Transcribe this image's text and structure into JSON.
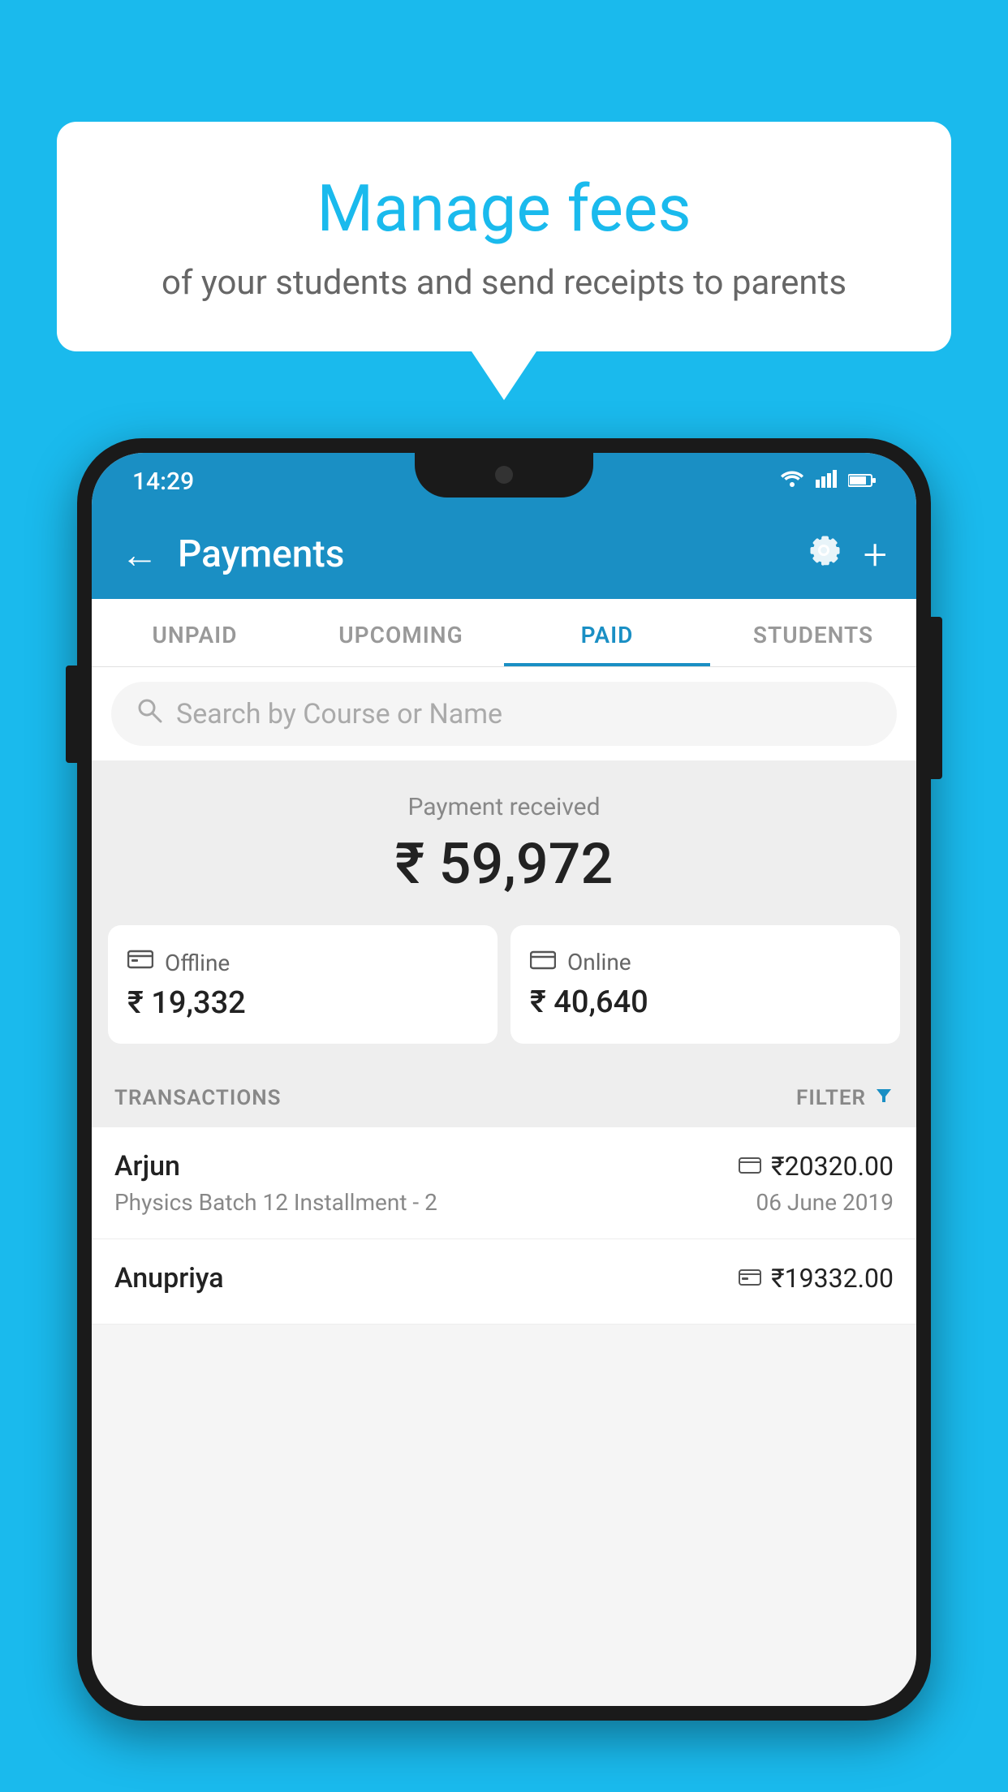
{
  "background_color": "#1ABAED",
  "speech_bubble": {
    "title": "Manage fees",
    "subtitle": "of your students and send receipts to parents"
  },
  "phone": {
    "status_bar": {
      "time": "14:29",
      "icons": [
        "wifi",
        "signal",
        "battery"
      ]
    },
    "app_bar": {
      "title": "Payments",
      "back_label": "←",
      "settings_icon": "gear",
      "add_icon": "+"
    },
    "tabs": [
      {
        "label": "UNPAID",
        "active": false
      },
      {
        "label": "UPCOMING",
        "active": false
      },
      {
        "label": "PAID",
        "active": true
      },
      {
        "label": "STUDENTS",
        "active": false
      }
    ],
    "search": {
      "placeholder": "Search by Course or Name"
    },
    "payment_received": {
      "label": "Payment received",
      "amount": "₹ 59,972"
    },
    "payment_cards": [
      {
        "icon": "offline",
        "label": "Offline",
        "amount": "₹ 19,332"
      },
      {
        "icon": "online",
        "label": "Online",
        "amount": "₹ 40,640"
      }
    ],
    "transactions_section": {
      "label": "TRANSACTIONS",
      "filter_label": "FILTER"
    },
    "transactions": [
      {
        "name": "Arjun",
        "amount": "₹20320.00",
        "course": "Physics Batch 12 Installment - 2",
        "date": "06 June 2019",
        "payment_type": "card"
      },
      {
        "name": "Anupriya",
        "amount": "₹19332.00",
        "course": "",
        "date": "",
        "payment_type": "offline"
      }
    ]
  }
}
